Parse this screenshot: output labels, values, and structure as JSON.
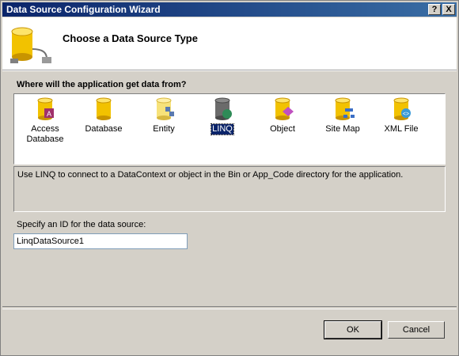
{
  "window": {
    "title": "Data Source Configuration Wizard",
    "help_label": "?",
    "close_label": "X"
  },
  "header": {
    "title": "Choose a Data Source Type",
    "icon": "database-plug-icon"
  },
  "question": "Where will the application get data from?",
  "types": [
    {
      "label": "Access\nDatabase",
      "icon": "access-database-icon",
      "selected": false
    },
    {
      "label": "Database",
      "icon": "database-icon",
      "selected": false
    },
    {
      "label": "Entity",
      "icon": "entity-icon",
      "selected": false
    },
    {
      "label": "LINQ",
      "icon": "linq-icon",
      "selected": true
    },
    {
      "label": "Object",
      "icon": "object-icon",
      "selected": false
    },
    {
      "label": "Site Map",
      "icon": "site-map-icon",
      "selected": false
    },
    {
      "label": "XML File",
      "icon": "xml-file-icon",
      "selected": false
    }
  ],
  "description": "Use LINQ to connect to a DataContext or object in the Bin or App_Code directory for the application.",
  "id_field": {
    "label": "Specify an ID for the data source:",
    "value": "LinqDataSource1"
  },
  "buttons": {
    "ok": "OK",
    "cancel": "Cancel"
  },
  "colors": {
    "title_start": "#0a246a",
    "title_end": "#3a6ea5",
    "cylinder": "#f2c200",
    "selection": "#0a246a"
  }
}
